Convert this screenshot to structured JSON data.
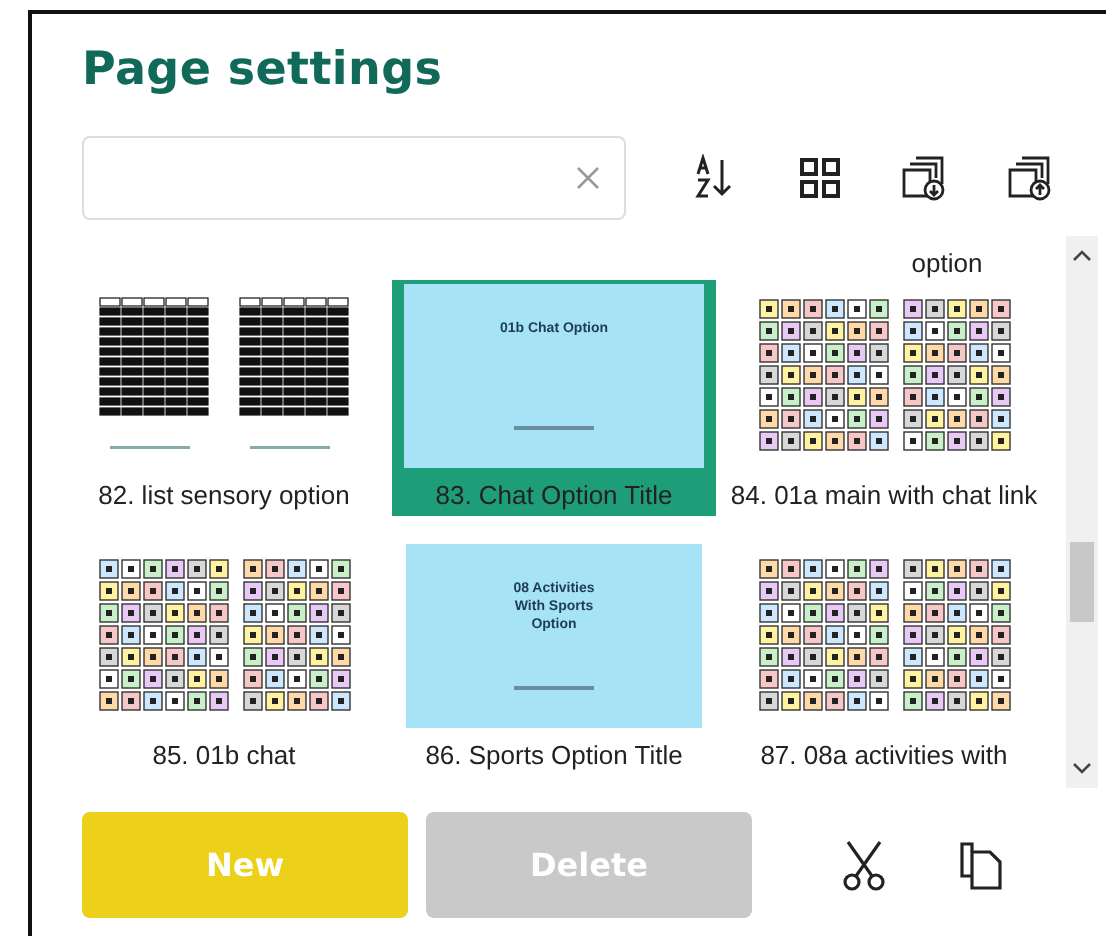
{
  "title": "Page settings",
  "toolbar": [
    {
      "kind": "sort"
    },
    {
      "kind": "grid"
    },
    {
      "kind": "import"
    },
    {
      "kind": "export"
    }
  ],
  "cut_label": "option",
  "pages": [
    {
      "label": "82. list sensory option",
      "kind": "list",
      "selected": false
    },
    {
      "label": "83. Chat Option Title",
      "kind": "title",
      "title_lines": [
        "01b Chat Option"
      ],
      "selected": true
    },
    {
      "label": "84. 01a main with chat link",
      "kind": "symbols",
      "selected": false
    },
    {
      "label": "85. 01b chat",
      "kind": "symbols",
      "selected": false
    },
    {
      "label": "86. Sports Option Title",
      "kind": "title",
      "title_lines": [
        "08 Activities",
        "With Sports",
        "Option"
      ],
      "selected": false
    },
    {
      "label": "87. 08a activities with",
      "kind": "symbols",
      "selected": false
    }
  ],
  "buttons": [
    {
      "label": "New",
      "disabled": false
    },
    {
      "label": "Delete",
      "disabled": true
    }
  ],
  "actions": [
    {
      "kind": "cut"
    },
    {
      "kind": "copy"
    }
  ]
}
